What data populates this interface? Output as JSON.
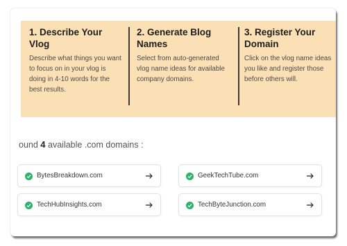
{
  "steps": [
    {
      "title": "1. Describe Your Vlog",
      "description": "Describe what things you want to focus on in your vlog is doing in 4-10 words for the best results."
    },
    {
      "title": "2. Generate Blog Names",
      "description": "Select from auto-generated vlog name ideas for available company domains."
    },
    {
      "title": "3. Register Your Domain",
      "description": "Click on the vlog name ideas you like and register those before others will."
    }
  ],
  "results": {
    "prefix": "ound",
    "count": "4",
    "suffix": "available .com domains :"
  },
  "domains": [
    {
      "name": "BytesBreakdown.com",
      "icon": "check-circle-icon",
      "action_icon": "arrow-right-icon"
    },
    {
      "name": "GeekTechTube.com",
      "icon": "check-circle-icon",
      "action_icon": "arrow-right-icon"
    },
    {
      "name": "TechHubInsights.com",
      "icon": "check-circle-icon",
      "action_icon": "arrow-right-icon"
    },
    {
      "name": "TechByteJunction.com",
      "icon": "check-circle-icon",
      "action_icon": "arrow-right-icon"
    }
  ],
  "colors": {
    "steps_background": "#fce0b5",
    "check_green": "#2ab36a",
    "divider": "#3a3a3a"
  }
}
